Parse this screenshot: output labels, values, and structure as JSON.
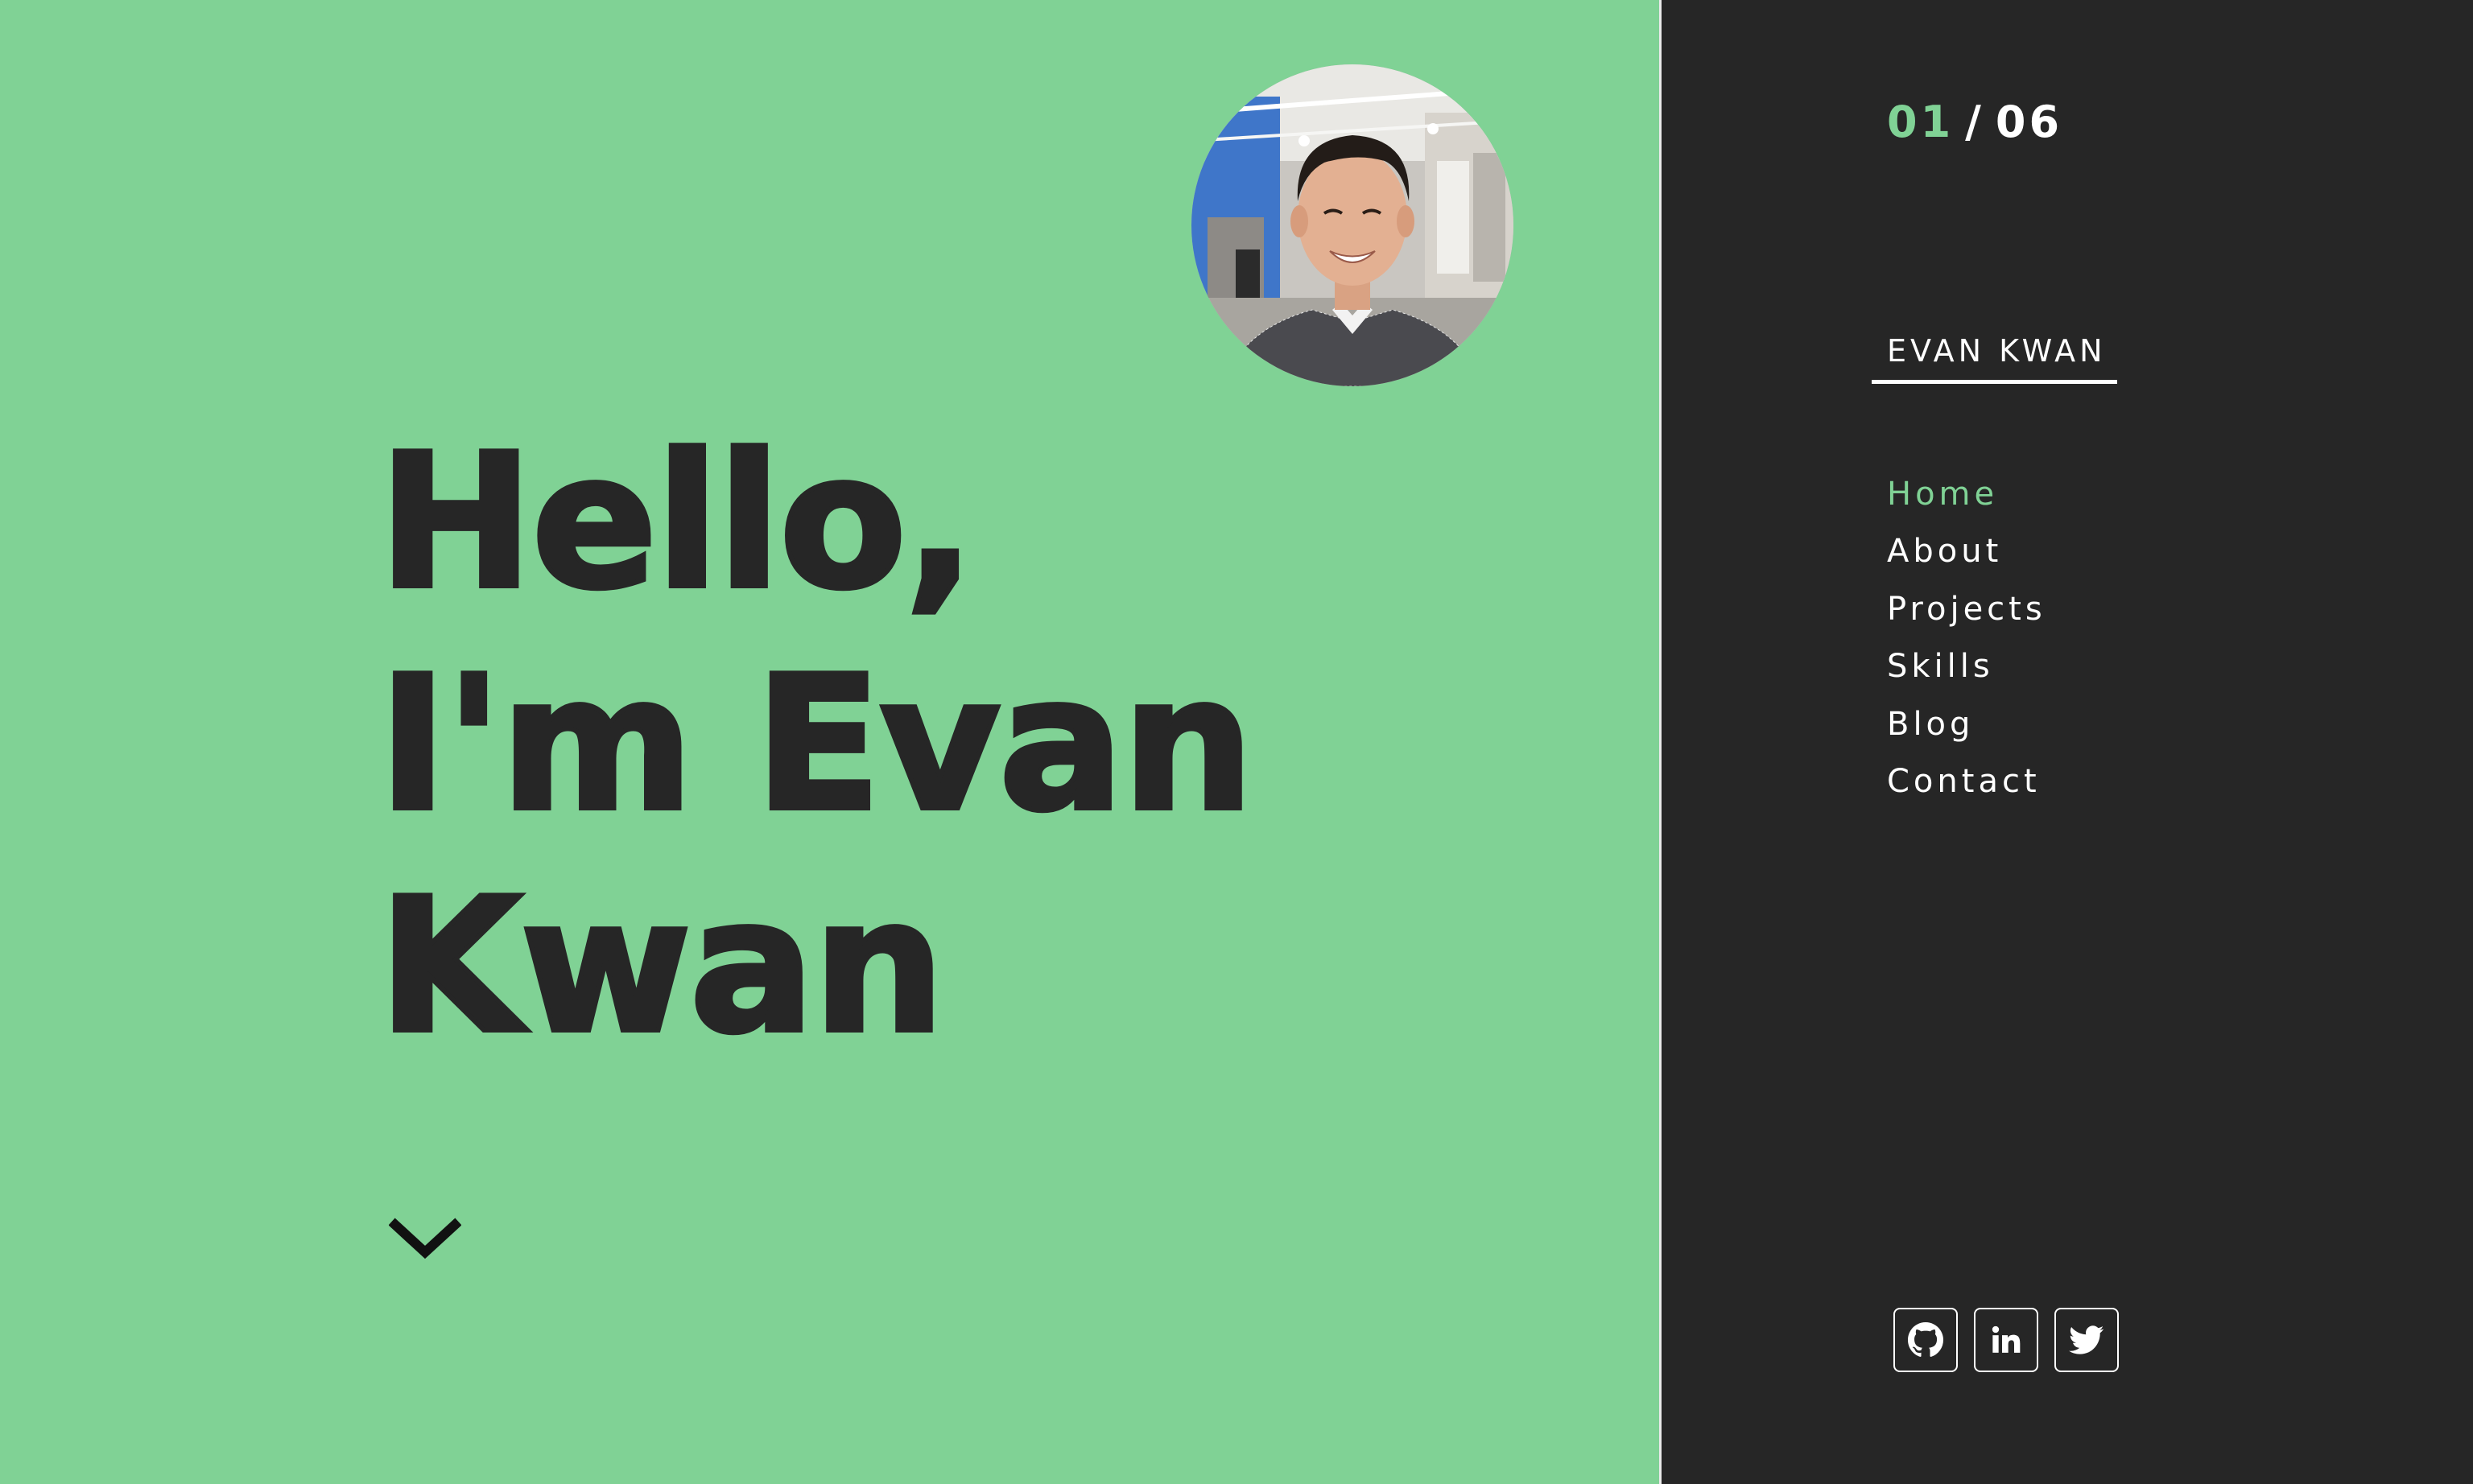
{
  "hero": {
    "headline_lines": [
      "Hello,",
      "I'm Evan",
      "Kwan"
    ],
    "background_color": "#80d295",
    "text_color": "#262626",
    "avatar_icon": "profile-photo",
    "scroll_icon": "chevron-down-icon"
  },
  "sidebar": {
    "background_color": "#262626",
    "accent_color": "#80d295",
    "counter": {
      "current": "01",
      "separator": "/",
      "total": "06"
    },
    "brand": "EVAN KWAN",
    "nav_items": [
      {
        "label": "Home",
        "active": true
      },
      {
        "label": "About",
        "active": false
      },
      {
        "label": "Projects",
        "active": false
      },
      {
        "label": "Skills",
        "active": false
      },
      {
        "label": "Blog",
        "active": false
      },
      {
        "label": "Contact",
        "active": false
      }
    ],
    "social": [
      {
        "icon": "github-icon"
      },
      {
        "icon": "linkedin-icon"
      },
      {
        "icon": "twitter-icon"
      }
    ]
  }
}
